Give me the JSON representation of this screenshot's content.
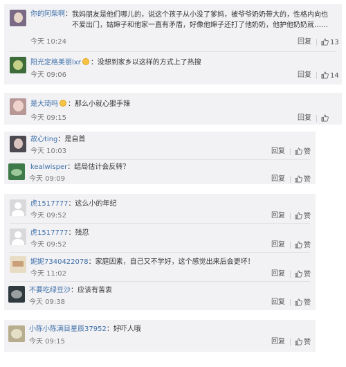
{
  "comments": [
    {
      "user": "你的阿柴啊",
      "text": "我妈朋友是他们哪儿的，说这个孩子从小没了爹妈，被爷爷奶奶带大的，性格内向也不爱出门，姑婶子和他家一直有矛盾，好像他婶子还打了他奶奶，他护他奶奶就……",
      "time": "今天 10:24",
      "reply": "回复",
      "likes": "13",
      "colors": [
        "#7a6a86",
        "#e8d7c8"
      ]
    },
    {
      "user": "阳光定格美丽lxr",
      "text": "没想到家乡以这样的方式上了热搜",
      "time": "今天 09:06",
      "reply": "回复",
      "likes": "14",
      "colors": [
        "#3e6b3a",
        "#c4cf88"
      ]
    },
    {
      "user": "是大琦吗",
      "text": "那么小就心狠手辣",
      "time": "今天 09:15",
      "reply": "回复",
      "likes": "",
      "colors": [
        "#b79896",
        "#efd2cb"
      ]
    },
    {
      "user": "故心ting",
      "text": "是自首",
      "time": "今天 10:03",
      "reply": "回复",
      "likes": "赞",
      "colors": [
        "#4c4a50",
        "#d9c4c0"
      ]
    },
    {
      "user": "kealwisper",
      "text": "结局估计会反转？",
      "time": "今天 09:09",
      "reply": "回复",
      "likes": "赞",
      "colors": [
        "#3f7a4a",
        "#9cc79a"
      ]
    },
    {
      "user": "虎1517777",
      "text": "这么小的年纪",
      "time": "今天 09:52",
      "reply": "回复",
      "likes": "赞",
      "colors": [
        "#d9d9dc",
        "#ffffff"
      ]
    },
    {
      "user": "虎1517777",
      "text": "残忍",
      "time": "今天 09:52",
      "reply": "回复",
      "likes": "赞",
      "colors": [
        "#d9d9dc",
        "#ffffff"
      ]
    },
    {
      "user": "妮妮7340422078",
      "text": "家庭因素，自己又不学好，这个感觉出来后会更坏！",
      "time": "今天 11:02",
      "reply": "回复",
      "likes": "赞",
      "colors": [
        "#e8dcc4",
        "#c9a07a"
      ]
    },
    {
      "user": "不要吃绿豆沙",
      "text": "应该有苦衷",
      "time": "今天 09:38",
      "reply": "回复",
      "likes": "赞",
      "colors": [
        "#2f3a3e",
        "#9aa0a2"
      ]
    },
    {
      "user": "小陈小陈满目星辰37952",
      "text": "好吓人哦",
      "time": "今天 09:15",
      "reply": "回复",
      "likes": "赞",
      "colors": [
        "#b8ad8e",
        "#e6dfc7"
      ]
    }
  ]
}
